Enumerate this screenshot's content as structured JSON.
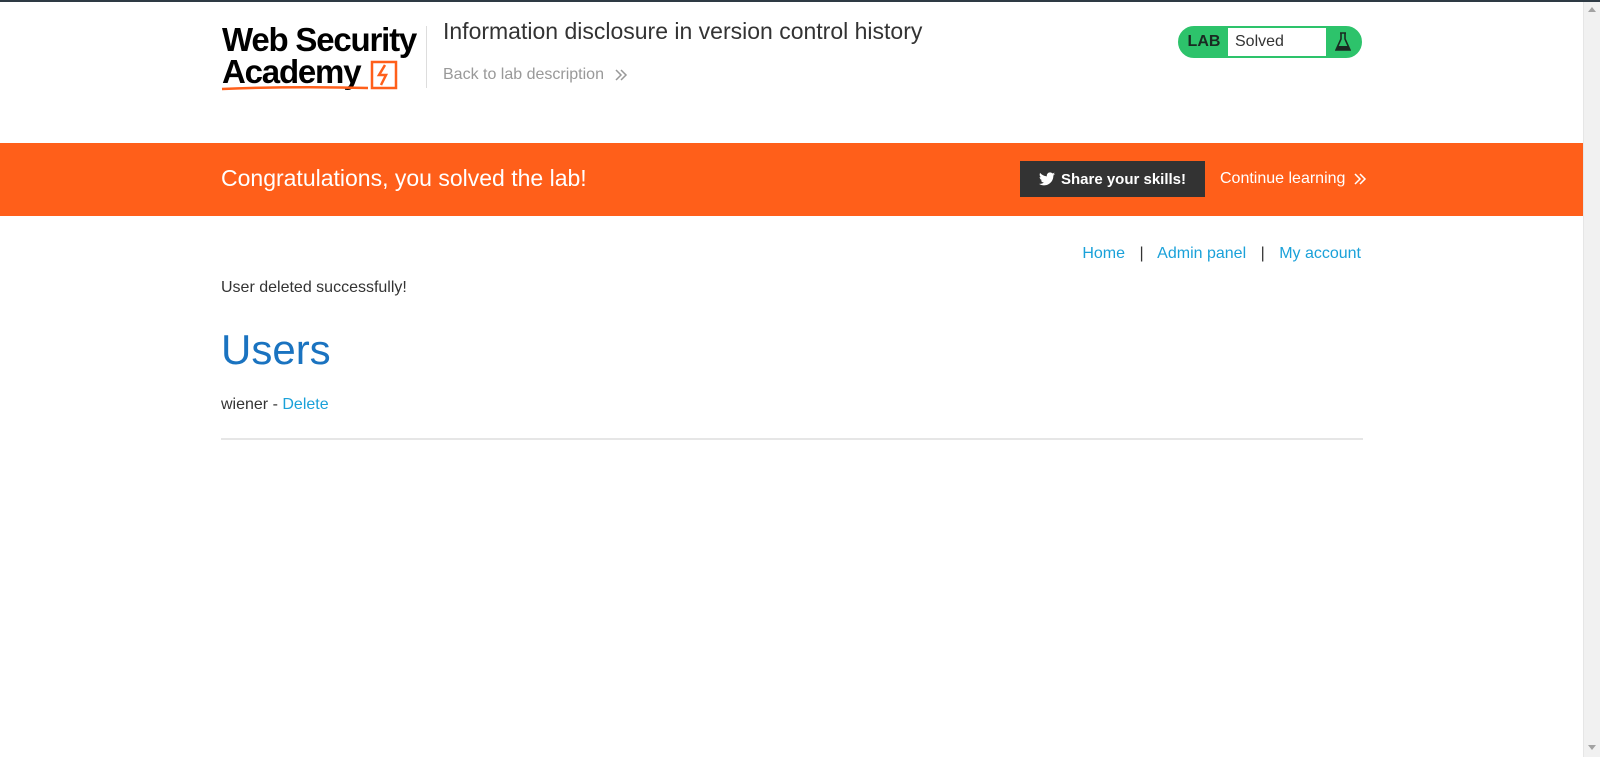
{
  "header": {
    "logo": {
      "line1": "Web Security",
      "line2": "Academy",
      "icon": "lightning-bolt-icon"
    },
    "lab_title": "Information disclosure in version control history",
    "back_link": "Back to lab description",
    "lab_status": {
      "tag": "LAB",
      "value": "Solved",
      "icon": "flask-icon"
    },
    "colors": {
      "status_green": "#2dc36b"
    }
  },
  "banner": {
    "message": "Congratulations, you solved the lab!",
    "share_button": "Share your skills!",
    "share_icon": "twitter-icon",
    "continue_link": "Continue learning",
    "color": "#ff5f1a"
  },
  "nav": {
    "items": [
      {
        "label": "Home"
      },
      {
        "label": "Admin panel"
      },
      {
        "label": "My account"
      }
    ],
    "separator": "|"
  },
  "main": {
    "notice": "User deleted successfully!",
    "heading": "Users",
    "users": [
      {
        "name": "wiener",
        "separator": " - ",
        "action": "Delete"
      }
    ]
  }
}
